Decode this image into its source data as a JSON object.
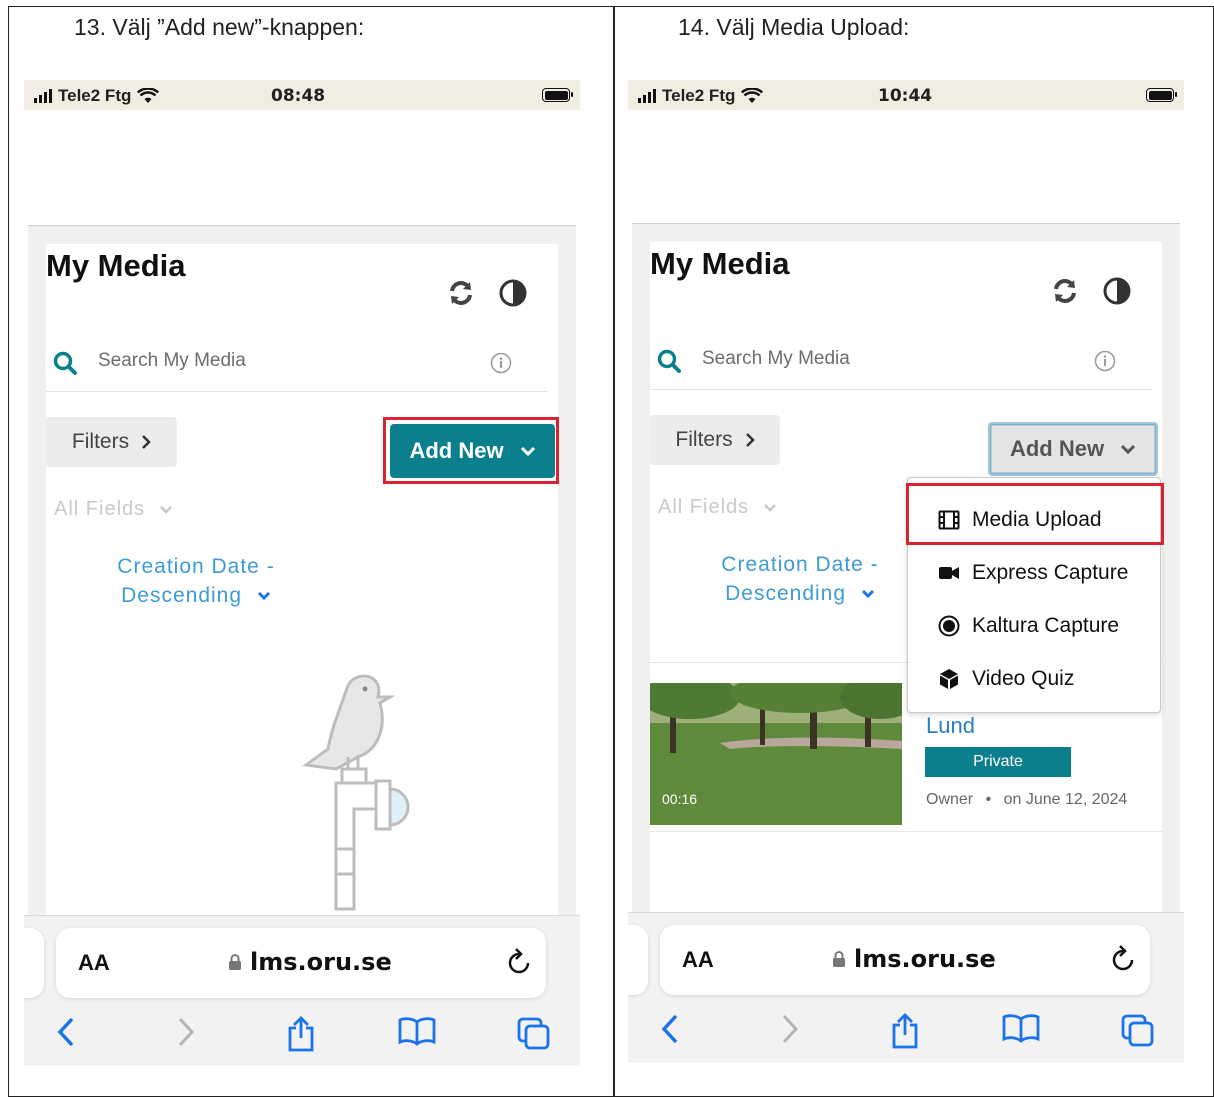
{
  "steps": [
    {
      "title": "13.  Välj ”Add new”-knappen:",
      "status": {
        "carrier": "Tele2 Ftg",
        "time": "08:48"
      },
      "page": {
        "heading": "My Media",
        "search_placeholder": "Search My Media",
        "filters_label": "Filters",
        "add_new_label": "Add New",
        "all_fields_label": "All Fields",
        "sort_label": "Creation Date - Descending"
      },
      "browser": {
        "text_size": "AA",
        "host": "lms.oru.se"
      }
    },
    {
      "title": "14.  Välj Media Upload:",
      "status": {
        "carrier": "Tele2 Ftg",
        "time": "10:44"
      },
      "page": {
        "heading": "My Media",
        "search_placeholder": "Search My Media",
        "filters_label": "Filters",
        "add_new_label": "Add New",
        "all_fields_label": "All Fields",
        "sort_label": "Creation Date - Descending",
        "menu": [
          "Media Upload",
          "Express Capture",
          "Kaltura Capture",
          "Video Quiz"
        ],
        "media": {
          "title": "Lund",
          "duration": "00:16",
          "badge": "Private",
          "owner": "Owner",
          "date": "on June 12, 2024"
        }
      },
      "browser": {
        "text_size": "AA",
        "host": "lms.oru.se"
      }
    }
  ],
  "colors": {
    "accent_teal": "#0b7f8c",
    "highlight_red": "#d9232f",
    "link_blue": "#3d9bd6",
    "ios_blue": "#1a73e8"
  }
}
